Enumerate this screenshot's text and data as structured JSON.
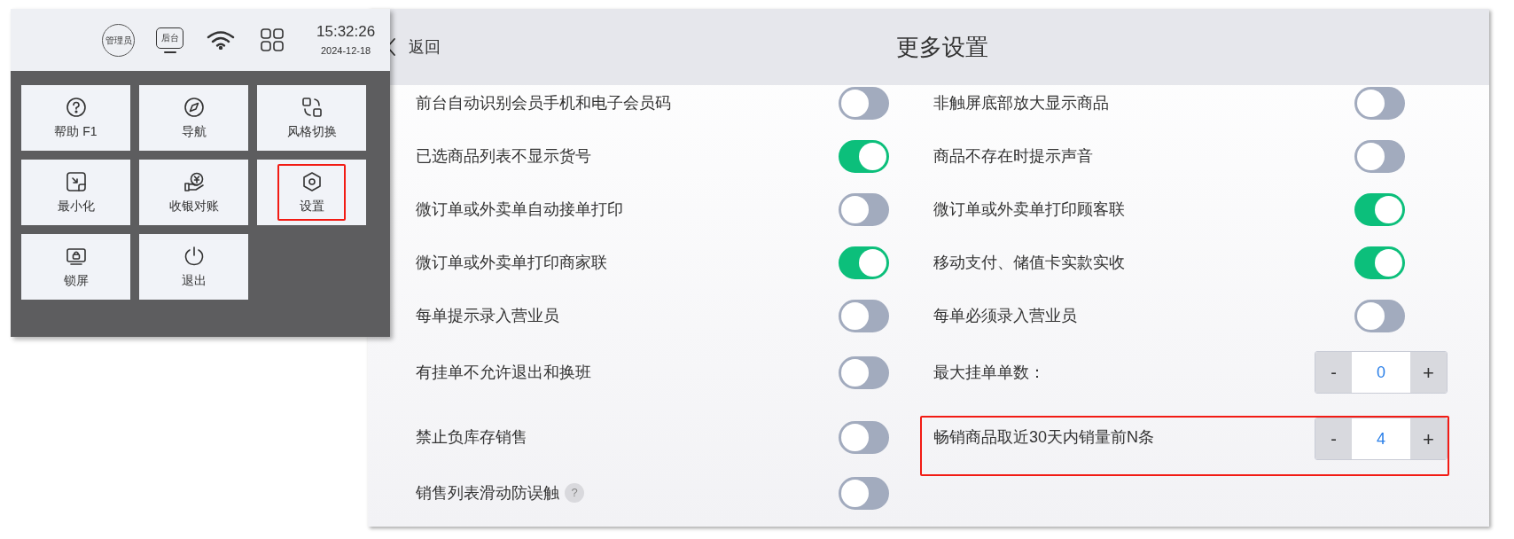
{
  "menu_screen": {
    "status_bar": {
      "user_badge": "管理员",
      "backend_button": "后台",
      "time": "15:32:26",
      "date": "2024-12-18"
    },
    "tiles": [
      {
        "label": "帮助 F1",
        "highlighted": false
      },
      {
        "label": "导航",
        "highlighted": false
      },
      {
        "label": "风格切换",
        "highlighted": false
      },
      {
        "label": "最小化",
        "highlighted": false
      },
      {
        "label": "收银对账",
        "highlighted": false
      },
      {
        "label": "设置",
        "highlighted": true
      },
      {
        "label": "锁屏",
        "highlighted": false
      },
      {
        "label": "退出",
        "highlighted": false
      }
    ]
  },
  "settings_screen": {
    "back": "返回",
    "title": "更多设置",
    "left_items": [
      {
        "kind": "toggle",
        "label": "前台自动识别会员手机和电子会员码",
        "on": false
      },
      {
        "kind": "toggle",
        "label": "已选商品列表不显示货号",
        "on": true
      },
      {
        "kind": "toggle",
        "label": "微订单或外卖单自动接单打印",
        "on": false
      },
      {
        "kind": "toggle",
        "label": "微订单或外卖单打印商家联",
        "on": true
      },
      {
        "kind": "toggle",
        "label": "每单提示录入营业员",
        "on": false
      },
      {
        "kind": "toggle",
        "label": "有挂单不允许退出和换班",
        "on": false
      },
      {
        "kind": "toggle",
        "label": "禁止负库存销售",
        "on": false
      },
      {
        "kind": "toggle",
        "label": "销售列表滑动防误触",
        "help_mark": "?",
        "on": false
      }
    ],
    "right_items": [
      {
        "kind": "toggle",
        "label": "非触屏底部放大显示商品",
        "on": false
      },
      {
        "kind": "toggle",
        "label": "商品不存在时提示声音",
        "on": false
      },
      {
        "kind": "toggle",
        "label": "微订单或外卖单打印顾客联",
        "on": true
      },
      {
        "kind": "toggle",
        "label": "移动支付、储值卡实款实收",
        "on": true
      },
      {
        "kind": "toggle",
        "label": "每单必须录入营业员",
        "on": false
      },
      {
        "kind": "stepper",
        "label": "最大挂单单数：",
        "minus": "-",
        "value": "0",
        "plus": "+",
        "highlighted": false
      },
      {
        "kind": "stepper",
        "label": "畅销商品取近30天内销量前N条",
        "minus": "-",
        "value": "4",
        "plus": "+",
        "highlighted": true
      }
    ]
  }
}
